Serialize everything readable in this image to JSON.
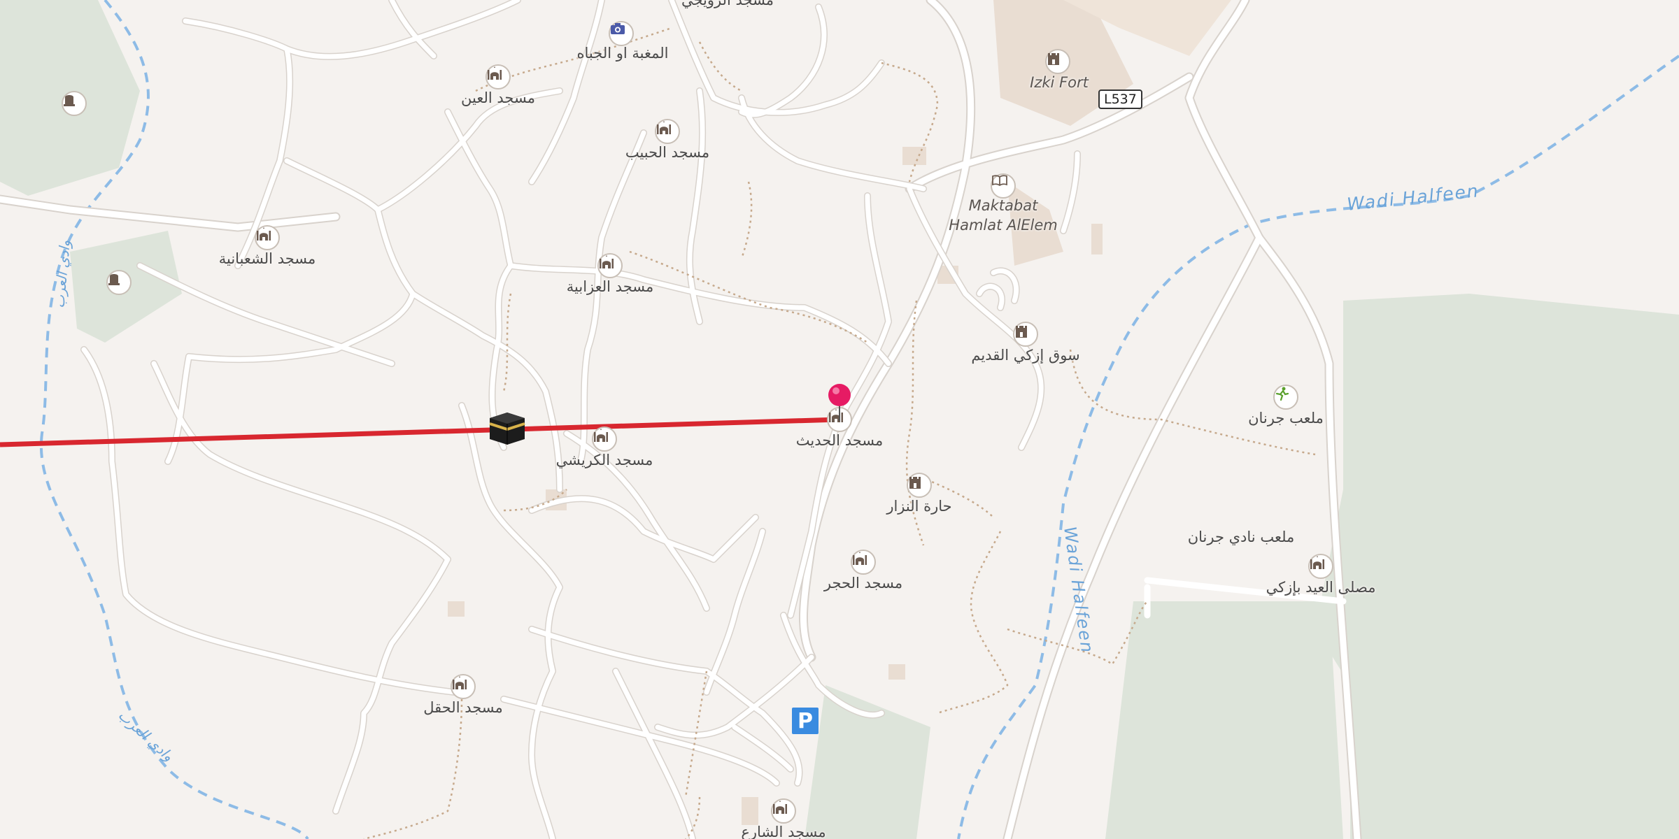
{
  "map": {
    "route_color": "#d8272f",
    "water_color": "#6aa3d8",
    "road_color": "#ffffff",
    "green_color": "#dde4da",
    "marker_color": "#e61b64",
    "road_shield": "L537",
    "parking_label": "P",
    "waterways": {
      "wadi_halfeen_1": "Wadi Halfeen",
      "wadi_halfeen_2": "Wadi Halfeen",
      "wadi_arabic_1": "وادي العرب",
      "wadi_arabic_2": "وادي العرب"
    },
    "labels": {
      "izki_fort": "Izki Fort",
      "maktabat_1": "Maktabat",
      "maktabat_2": "Hamlat AlElem",
      "mughbat": "المغبة او الجباه",
      "masjid_ain": "مسجد العين",
      "masjid_habib": "مسجد الحبيب",
      "masjid_shabania": "مسجد الشعبانية",
      "masjid_azabia": "مسجد العزابية",
      "souq_izki": "سوق إزكي القديم",
      "malab_jarnan": "ملعب جرنان",
      "masjid_hadith": "مسجد الحديث",
      "masjid_kraishi": "مسجد الكريشي",
      "harat_nizar": "حارة النزار",
      "malab_nadi": "ملعب نادي جرنان",
      "musalla_eid": "مصلى العيد بإزكي",
      "masjid_hajar": "مسجد الحجر",
      "masjid_haql": "مسجد الحقل",
      "masjid_shari": "مسجد الشارع",
      "top_cut": "مسجد الرويجي"
    },
    "icons": {
      "mosque": "mosque-icon",
      "castle": "castle-icon",
      "camera": "viewpoint-icon",
      "book": "library-icon",
      "sport": "sports-icon",
      "grave": "cemetery-icon",
      "kaaba": "kaaba-icon",
      "marker": "location-marker-icon"
    }
  }
}
